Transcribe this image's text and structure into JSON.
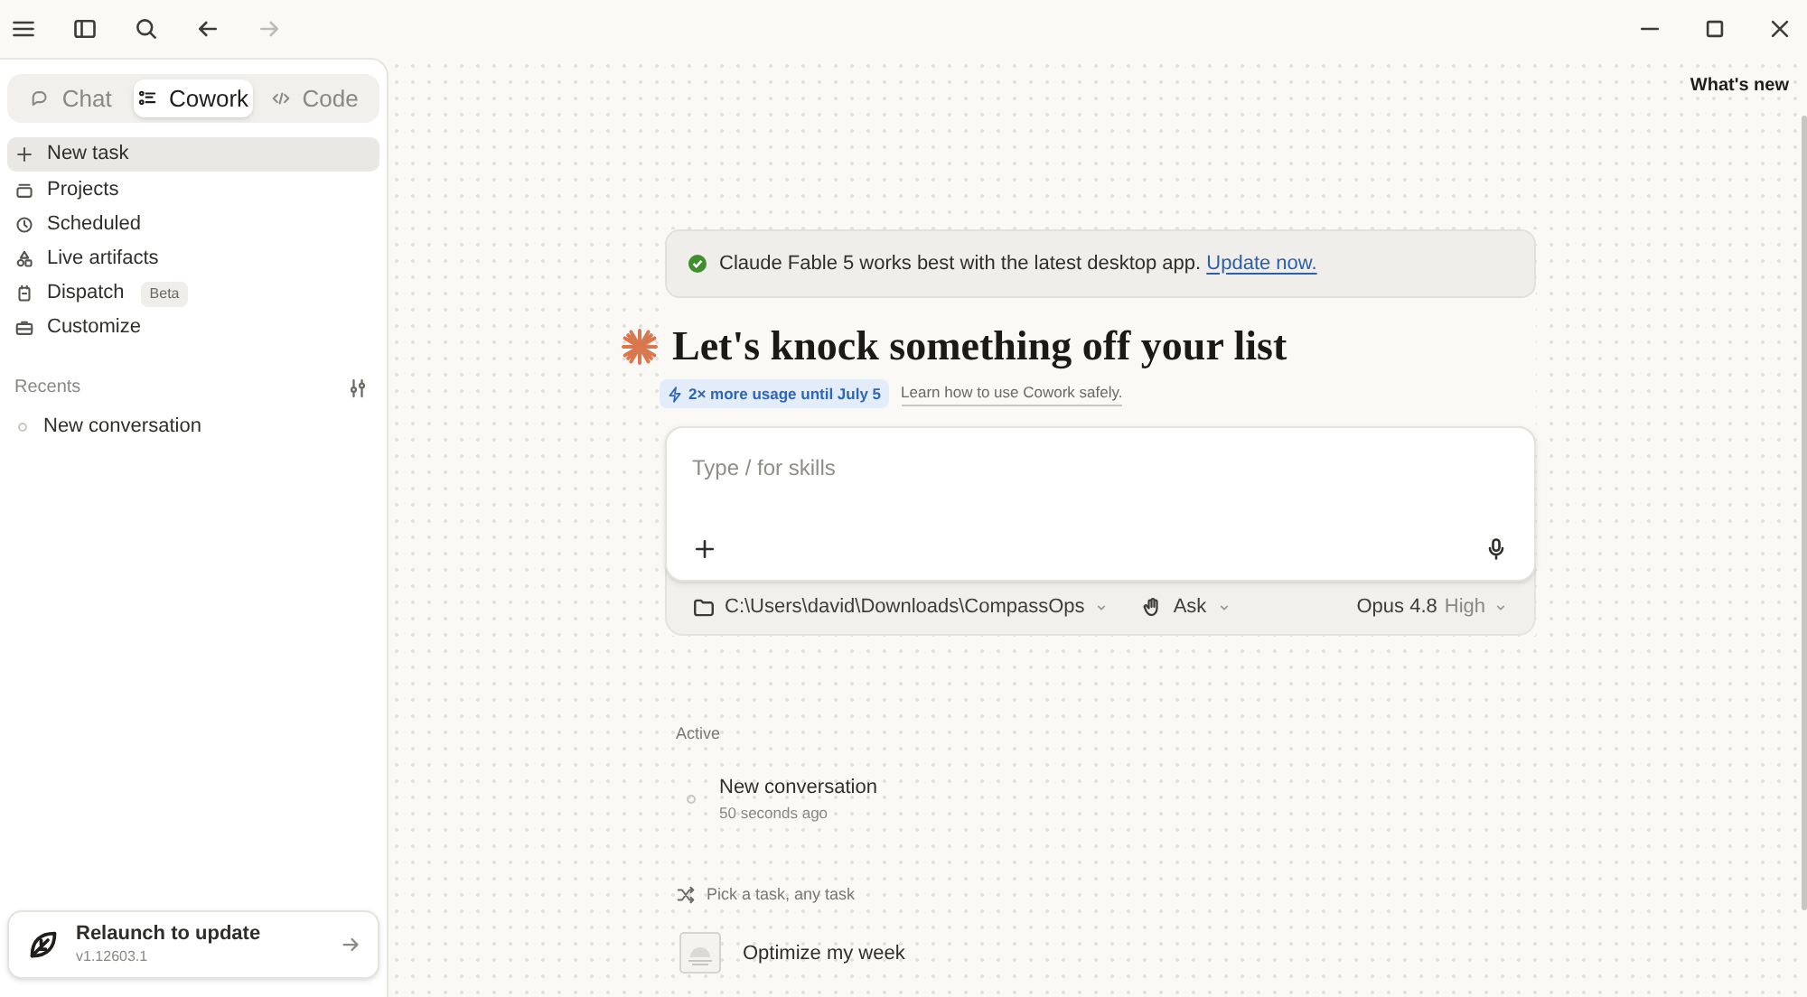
{
  "titlebar": {
    "right_link": "What's new"
  },
  "tabs": [
    {
      "kind": "chat",
      "label": "Chat",
      "selected": false
    },
    {
      "kind": "cowork",
      "label": "Cowork",
      "selected": true
    },
    {
      "kind": "code",
      "label": "Code",
      "selected": false
    }
  ],
  "nav": [
    {
      "kind": "plus",
      "label": "New task",
      "selected": true
    },
    {
      "kind": "projects",
      "label": "Projects",
      "selected": false
    },
    {
      "kind": "clock",
      "label": "Scheduled",
      "selected": false
    },
    {
      "kind": "artifacts",
      "label": "Live artifacts",
      "selected": false
    },
    {
      "kind": "dispatch",
      "label": "Dispatch",
      "badge": "Beta",
      "selected": false
    },
    {
      "kind": "briefcase",
      "label": "Customize",
      "selected": false
    }
  ],
  "recents": {
    "title": "Recents",
    "items": [
      "New conversation"
    ]
  },
  "update_card": {
    "title": "Relaunch to update",
    "version": "v1.12603.1"
  },
  "banner": {
    "text": "Claude Fable 5 works best with the latest desktop app.",
    "link": "Update now."
  },
  "heading": "Let's knock something off your list",
  "promo": {
    "chip": "2× more usage until July 5",
    "link": "Learn how to use Cowork safely."
  },
  "composer": {
    "placeholder": "Type / for skills",
    "folder": "C:\\Users\\david\\Downloads\\CompassOps",
    "mode": "Ask",
    "model": "Opus 4.8",
    "effort": "High"
  },
  "active": {
    "title": "Active",
    "items": [
      {
        "title": "New conversation",
        "time": "50 seconds ago"
      }
    ]
  },
  "suggestions": {
    "title": "Pick a task, any task",
    "items": [
      "Optimize my week"
    ]
  }
}
